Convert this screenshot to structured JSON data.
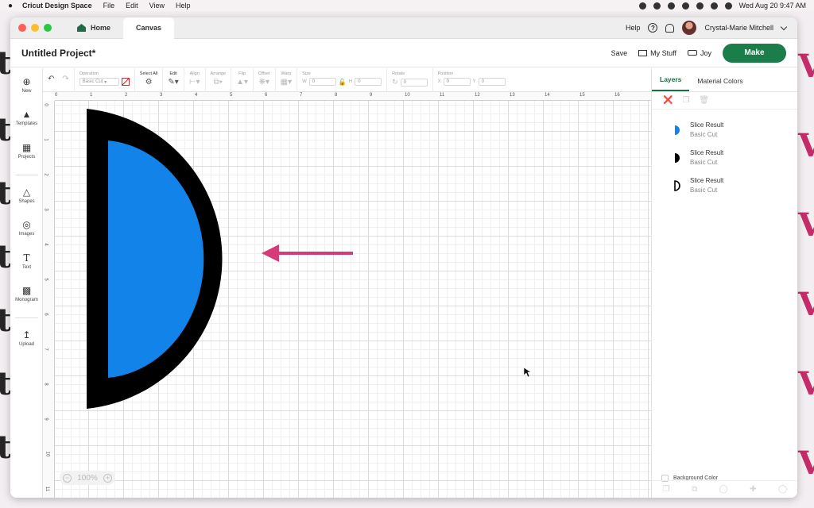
{
  "menubar": {
    "app_name": "Cricut Design Space",
    "items": [
      "File",
      "Edit",
      "View",
      "Help"
    ],
    "clock": "Wed Aug 20  9:47 AM"
  },
  "window": {
    "tabs": [
      {
        "label": "Home"
      },
      {
        "label": "Canvas"
      }
    ],
    "help_label": "Help",
    "user_name": "Crystal-Marie Mitchell"
  },
  "header": {
    "project_title": "Untitled Project*",
    "save_label": "Save",
    "mystuff_label": "My Stuff",
    "joy_label": "Joy",
    "make_label": "Make"
  },
  "leftnav": {
    "items": [
      {
        "label": "New",
        "icon": "plus-circle-icon"
      },
      {
        "label": "Templates",
        "icon": "shirt-icon"
      },
      {
        "label": "Projects",
        "icon": "clipboard-icon"
      },
      {
        "label": "Shapes",
        "icon": "shapes-icon"
      },
      {
        "label": "Images",
        "icon": "bulb-icon"
      },
      {
        "label": "Text",
        "icon": "text-icon"
      },
      {
        "label": "Monogram",
        "icon": "monogram-icon"
      },
      {
        "label": "Upload",
        "icon": "upload-icon"
      }
    ]
  },
  "toolbar": {
    "operation_label": "Operation",
    "operation_value": "Basic Cut",
    "select_all_label": "Select All",
    "edit_label": "Edit",
    "align_label": "Align",
    "arrange_label": "Arrange",
    "flip_label": "Flip",
    "offset_label": "Offset",
    "warp_label": "Warp",
    "size_label": "Size",
    "w_label": "W",
    "w_value": "0",
    "h_label": "H",
    "h_value": "0",
    "rotate_label": "Rotate",
    "rotate_value": "0",
    "position_label": "Position",
    "x_label": "X",
    "x_value": "0",
    "y_label": "Y",
    "y_value": "0"
  },
  "rulers": {
    "top": [
      "0",
      "1",
      "2",
      "3",
      "4",
      "5",
      "6",
      "7",
      "8",
      "9",
      "10",
      "11",
      "12",
      "13",
      "14",
      "15",
      "16"
    ],
    "left": [
      "0",
      "1",
      "2",
      "3",
      "4",
      "5",
      "6",
      "7",
      "8",
      "9",
      "10",
      "11"
    ]
  },
  "canvas": {
    "outer_shape_color": "#000000",
    "inner_shape_color": "#1283e8",
    "arrow_color": "#d63a78",
    "zoom_level": "100%"
  },
  "rightpanel": {
    "tabs": [
      "Layers",
      "Material Colors"
    ],
    "layers": [
      {
        "name": "Slice Result",
        "type": "Basic Cut",
        "thumb": "blue-half"
      },
      {
        "name": "Slice Result",
        "type": "Basic Cut",
        "thumb": "black-half"
      },
      {
        "name": "Slice Result",
        "type": "Basic Cut",
        "thumb": "outline-half"
      }
    ],
    "background_color_label": "Background Color"
  },
  "colors": {
    "accent": "#1b7d4a",
    "watermark_pink": "#c2185b"
  }
}
